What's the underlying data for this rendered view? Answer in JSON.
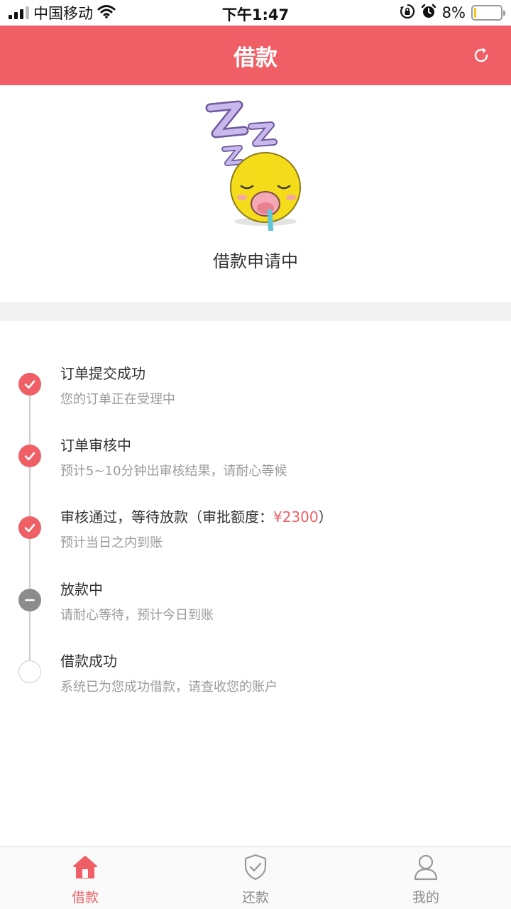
{
  "status_bar": {
    "carrier": "中国移动",
    "time": "下午1:47",
    "battery_percent": "8%",
    "battery_level": 0.08,
    "icons": [
      "signal-icon",
      "wifi-icon",
      "rotation-lock-icon",
      "alarm-icon",
      "battery-icon"
    ]
  },
  "header": {
    "title": "借款",
    "action_icon": "refresh-icon"
  },
  "hero": {
    "illustration": "sleeping-face-zzz",
    "status": "借款申请中"
  },
  "timeline": {
    "steps": [
      {
        "title": "订单提交成功",
        "desc": "您的订单正在受理中",
        "state": "done"
      },
      {
        "title": "订单审核中",
        "desc": "预计5~10分钟出审核结果，请耐心等候",
        "state": "done"
      },
      {
        "title_prefix": "审核通过，等待放款（审批额度：",
        "amount": "¥2300",
        "title_suffix": "）",
        "desc": "预计当日之内到账",
        "state": "done"
      },
      {
        "title": "放款中",
        "desc": "请耐心等待，预计今日到账",
        "state": "in-progress"
      },
      {
        "title": "借款成功",
        "desc": "系统已为您成功借款，请查收您的账户",
        "state": "pending"
      }
    ]
  },
  "tab_bar": {
    "tabs": [
      {
        "label": "借款",
        "icon": "home-icon",
        "active": true
      },
      {
        "label": "还款",
        "icon": "shield-check-icon",
        "active": false
      },
      {
        "label": "我的",
        "icon": "user-icon",
        "active": false
      }
    ]
  },
  "colors": {
    "accent": "#ef5f65",
    "in_progress": "#8c8c8c",
    "muted_text": "#9b9b9b",
    "background_band": "#f2f2f2"
  }
}
